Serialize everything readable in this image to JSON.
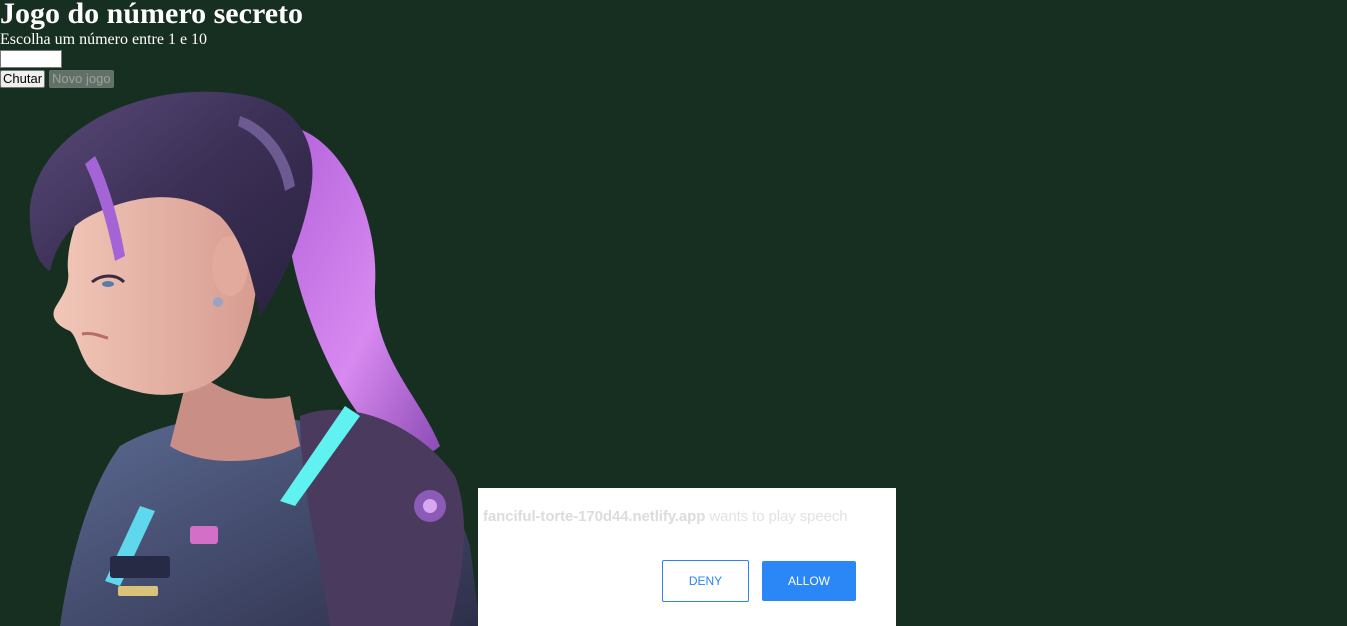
{
  "game": {
    "title": "Jogo do número secreto",
    "instruction": "Escolha um número entre 1 e 10",
    "input_value": "",
    "guess_button": "Chutar",
    "new_game_button": "Novo jogo"
  },
  "portrait": {
    "icon": "woman-portrait-illustration",
    "colors": {
      "hair": "#7a4a9e",
      "hair_highlight": "#c77be0",
      "skin": "#e6b8a8",
      "suit": "#4a4f72",
      "neon": "#5ff2f0"
    }
  },
  "permission_dialog": {
    "site": "fanciful-torte-170d44.netlify.app",
    "message": "wants to play speech",
    "deny_label": "DENY",
    "allow_label": "ALLOW",
    "accent_color": "#2a84f4"
  },
  "colors": {
    "background": "#162f20"
  }
}
